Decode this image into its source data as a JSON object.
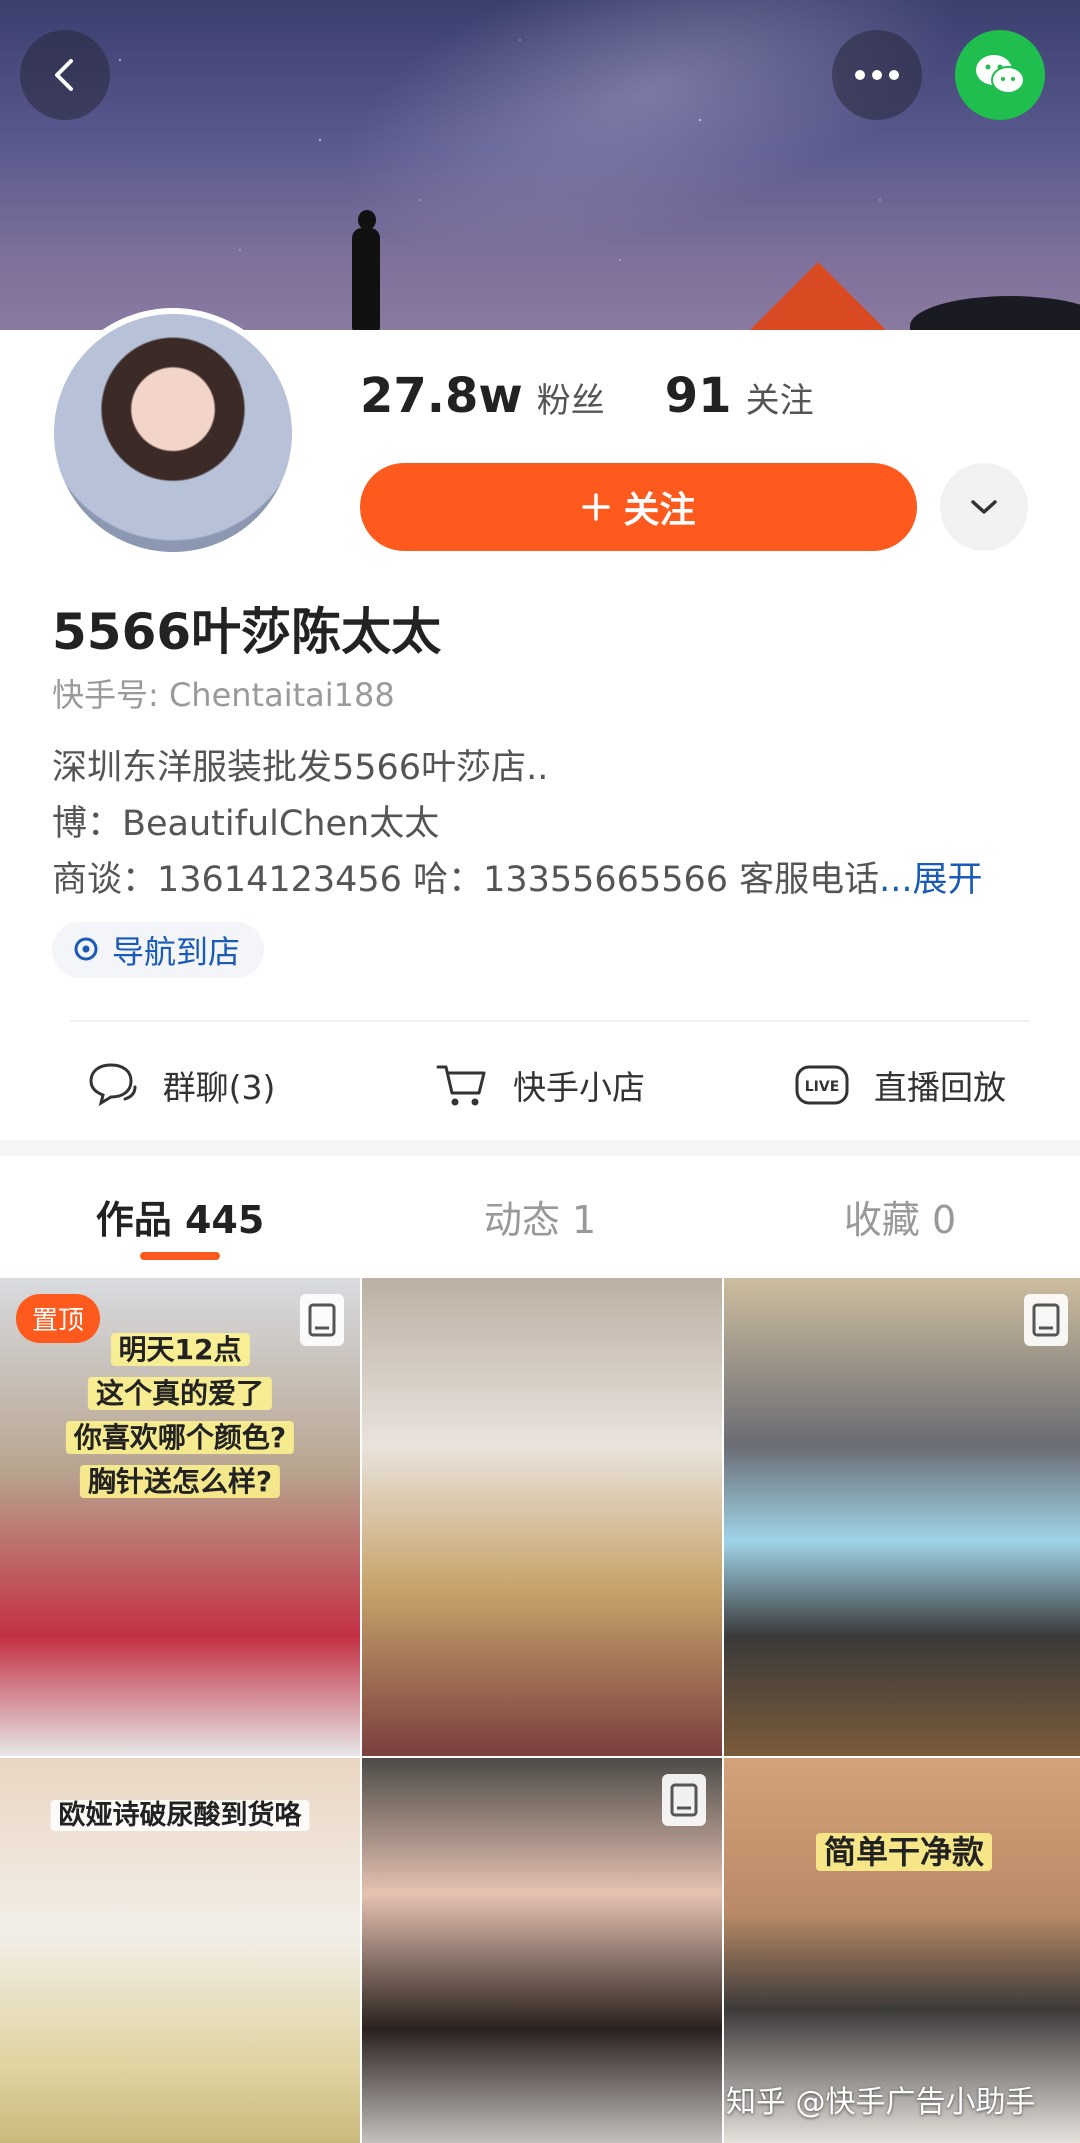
{
  "header": {
    "back_icon": "chevron-left-icon",
    "more_icon": "ellipsis-icon",
    "share_icon": "wechat-icon",
    "accent_color": "#1fbe4e"
  },
  "profile": {
    "fans_count": "27.8w",
    "fans_label": "粉丝",
    "following_count": "91",
    "following_label": "关注",
    "follow_button_label": "关注",
    "follow_icon": "plus-icon",
    "follow_button_color": "#fe5a1e",
    "dropdown_icon": "chevron-down-icon",
    "name": "5566叶莎陈太太",
    "account_id": "快手号: Chentaitai188",
    "bio_line_1": "深圳东洋服装批发5566叶莎店..",
    "bio_line_2": "博：BeautifulChen太太",
    "bio_line_3": "商谈：13614123456 哈：13355665566 客服电话",
    "bio_expand_label": "...展开",
    "nav_chip_label": "导航到店",
    "nav_chip_icon": "location-pin-icon"
  },
  "actions": [
    {
      "label": "群聊(3)",
      "icon": "chat-bubble-icon"
    },
    {
      "label": "快手小店",
      "icon": "shopping-cart-icon"
    },
    {
      "label": "直播回放",
      "icon": "live-icon"
    }
  ],
  "tabs": [
    {
      "label": "作品 445",
      "active": true
    },
    {
      "label": "动态 1",
      "active": false
    },
    {
      "label": "收藏 0",
      "active": false
    }
  ],
  "grid": {
    "pinned_badge": "置顶",
    "cell1_caption_lines": [
      "明天12点",
      "这个真的爱了",
      "你喜欢哪个颜色?",
      "胸针送怎么样?"
    ],
    "cell4_caption": "欧娅诗破尿酸到货咯",
    "cell6_caption": "简单干净款"
  },
  "watermark": "知乎 @快手广告小助手"
}
